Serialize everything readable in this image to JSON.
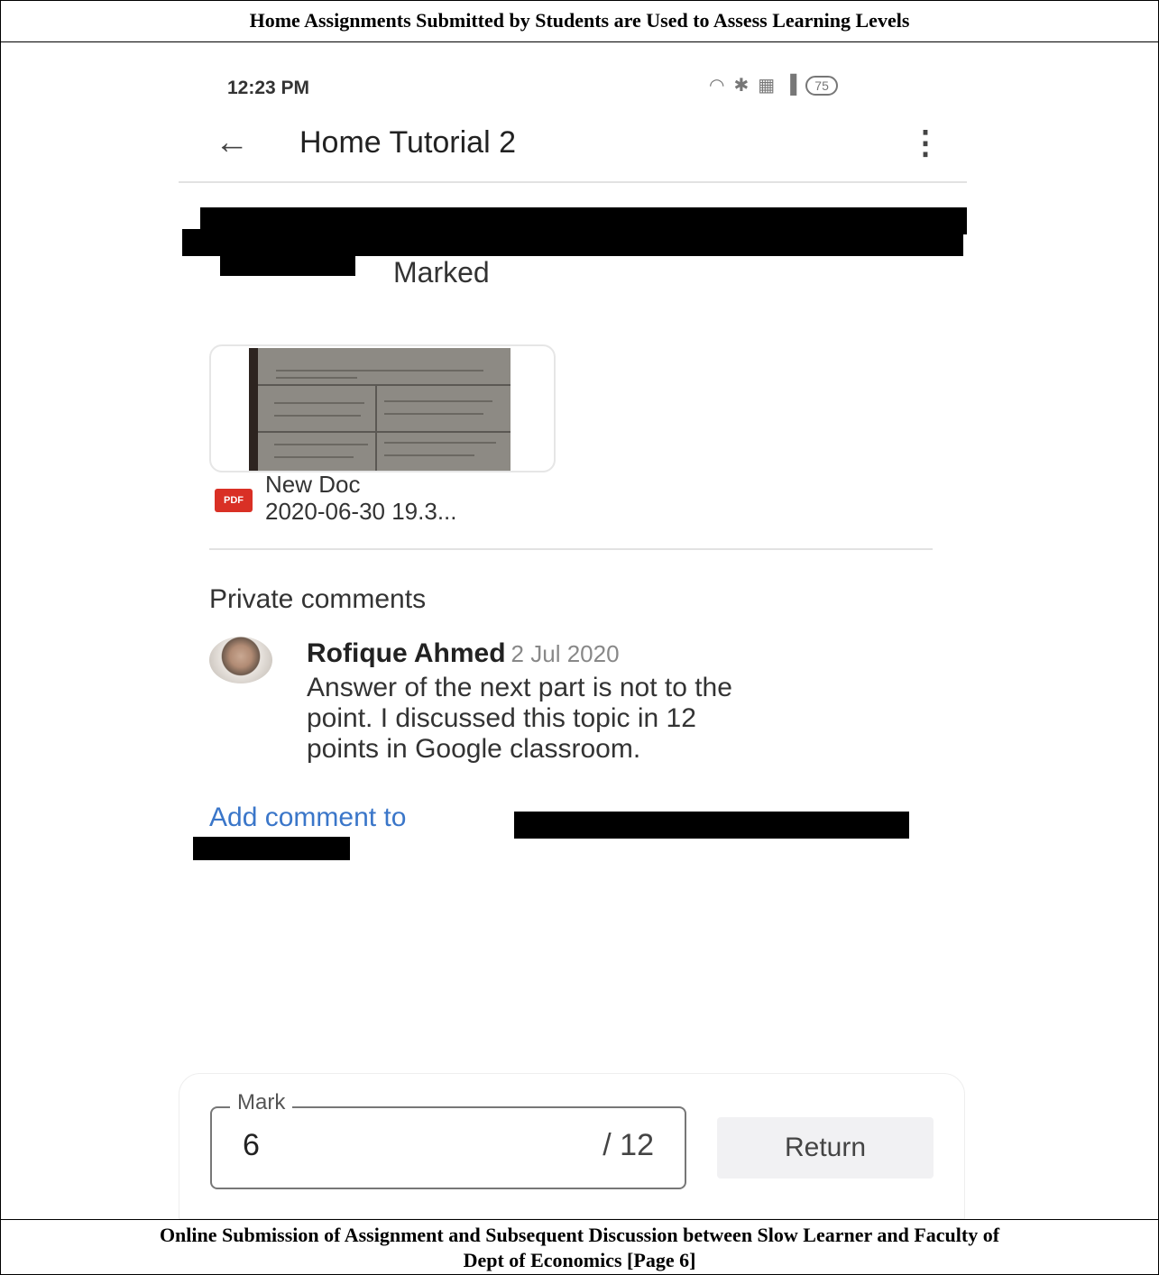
{
  "captions": {
    "top": "Home Assignments Submitted by Students are Used to Assess Learning Levels",
    "bottom_line1": "Online Submission of Assignment and Subsequent Discussion between Slow Learner and Faculty of",
    "bottom_line2": "Dept of Economics [Page 6]"
  },
  "status_bar": {
    "time": "12:23 PM",
    "battery": "75"
  },
  "app_bar": {
    "back_icon": "back-arrow-icon",
    "title": "Home Tutorial 2",
    "menu_icon": "more-vert-icon"
  },
  "submission": {
    "status": "Marked"
  },
  "attachment": {
    "type_label": "PDF",
    "name_line1": "New Doc",
    "name_line2": "2020-06-30 19.3..."
  },
  "comments": {
    "heading": "Private comments",
    "items": [
      {
        "author": "Rofique Ahmed",
        "date": "2 Jul 2020",
        "line1": "Answer of the next part is not to the",
        "line2": "point. I discussed this topic in 12",
        "line3": "points in Google classroom."
      }
    ],
    "add_label": "Add comment to"
  },
  "grading": {
    "mark_label": "Mark",
    "mark_value": "6",
    "mark_total": "/ 12",
    "return_label": "Return"
  },
  "colors": {
    "link": "#3a76c9",
    "pdf_red": "#d93025"
  }
}
